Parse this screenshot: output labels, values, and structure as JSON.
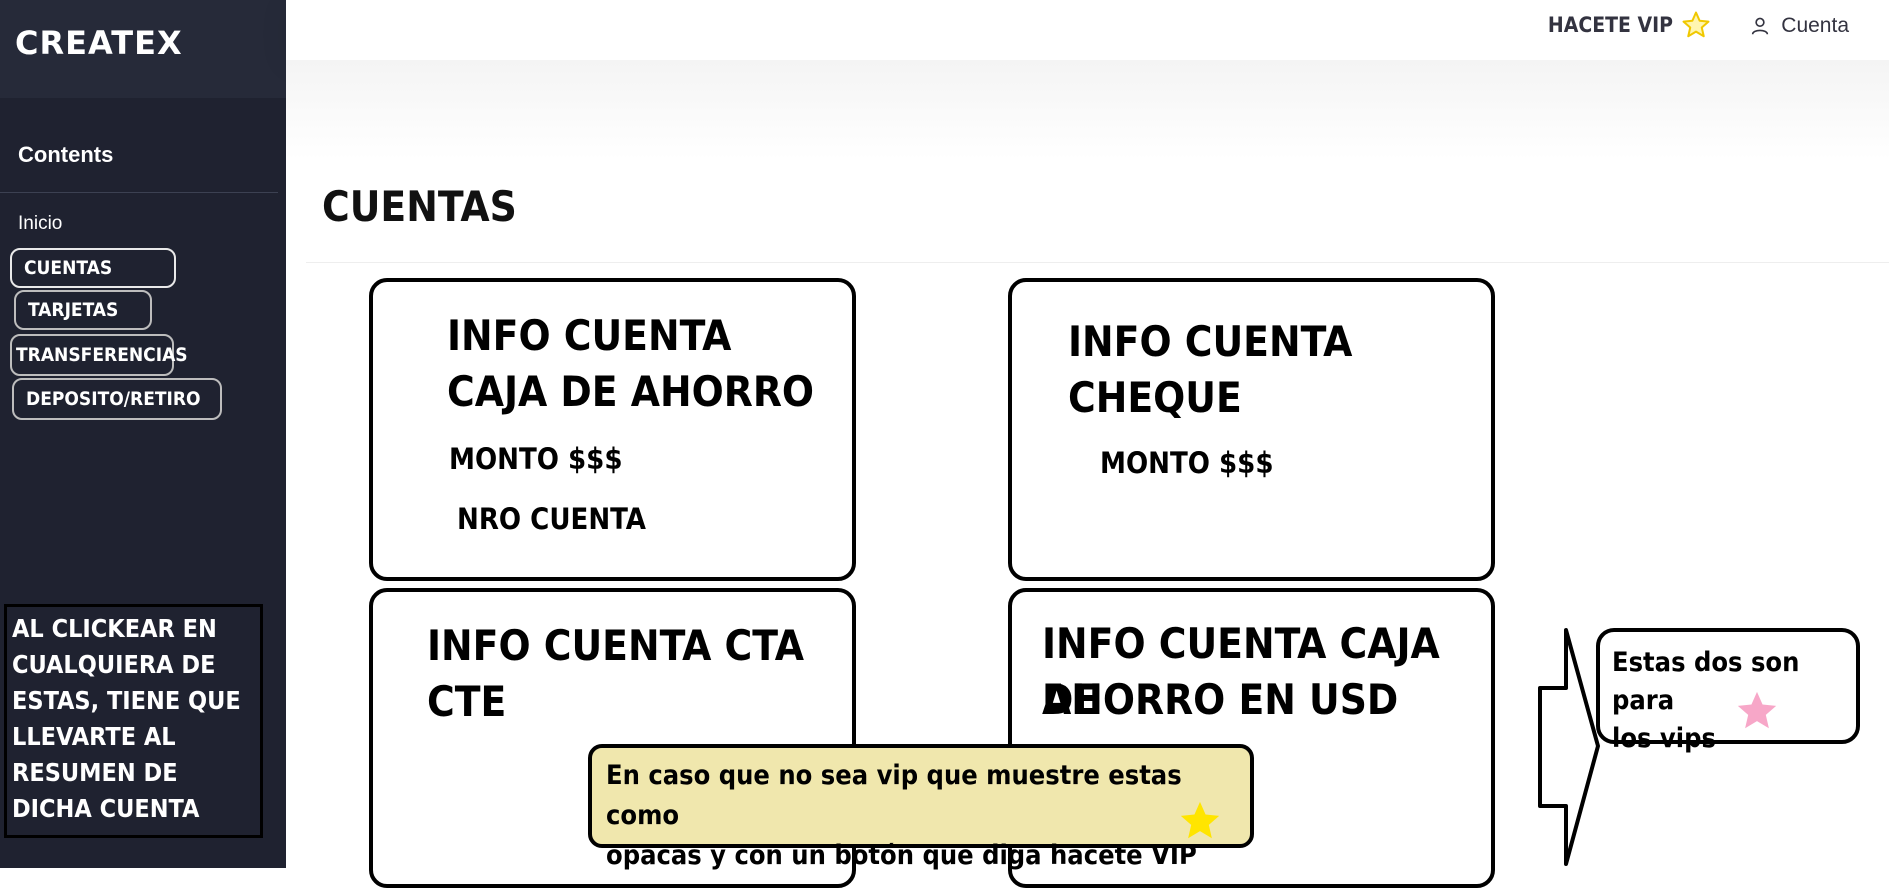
{
  "sidebar": {
    "brand": "CREATEX",
    "section_title": "Contents",
    "items": [
      {
        "label": "Inicio"
      },
      {
        "label": "CUENTAS"
      },
      {
        "label": "TARJETAS"
      },
      {
        "label": "TRANSFERENCIAS"
      },
      {
        "label": "DEPOSITO/RETIRO"
      }
    ],
    "note": "AL CLICKEAR EN CUALQUIERA DE ESTAS, TIENE QUE LLEVARTE AL RESUMEN DE DICHA CUENTA"
  },
  "topbar": {
    "vip_label": "HACETE VIP",
    "vip_icon": "star-outline-icon",
    "account_label": "Cuenta",
    "account_icon": "user-icon"
  },
  "page": {
    "title": "CUENTAS"
  },
  "cards": [
    {
      "title_line1": "INFO CUENTA",
      "title_line2": "CAJA DE AHORRO",
      "monto": "MONTO $$$",
      "nro": "NRO CUENTA"
    },
    {
      "title_line1": "INFO CUENTA",
      "title_line2": "CHEQUE",
      "monto": "MONTO $$$"
    },
    {
      "title_line1": "INFO CUENTA CTA",
      "title_line2": "CTE"
    },
    {
      "title_line1": "INFO CUENTA CAJA DE",
      "title_line2": "AHORRO EN USD"
    }
  ],
  "annotations": {
    "vip_note_line1": "Estas dos son para",
    "vip_note_line2": "los vips",
    "yellow_note_line1": "En caso que no sea vip que muestre estas como",
    "yellow_note_line2": "opacas y con un botón que diga hacete VIP"
  },
  "colors": {
    "sidebar_bg": "#1f2230",
    "brand_bg": "#262a39",
    "star_yellow": "#ffe500",
    "star_pink": "#f7a7c8",
    "note_yellow": "#f0e7ad"
  }
}
